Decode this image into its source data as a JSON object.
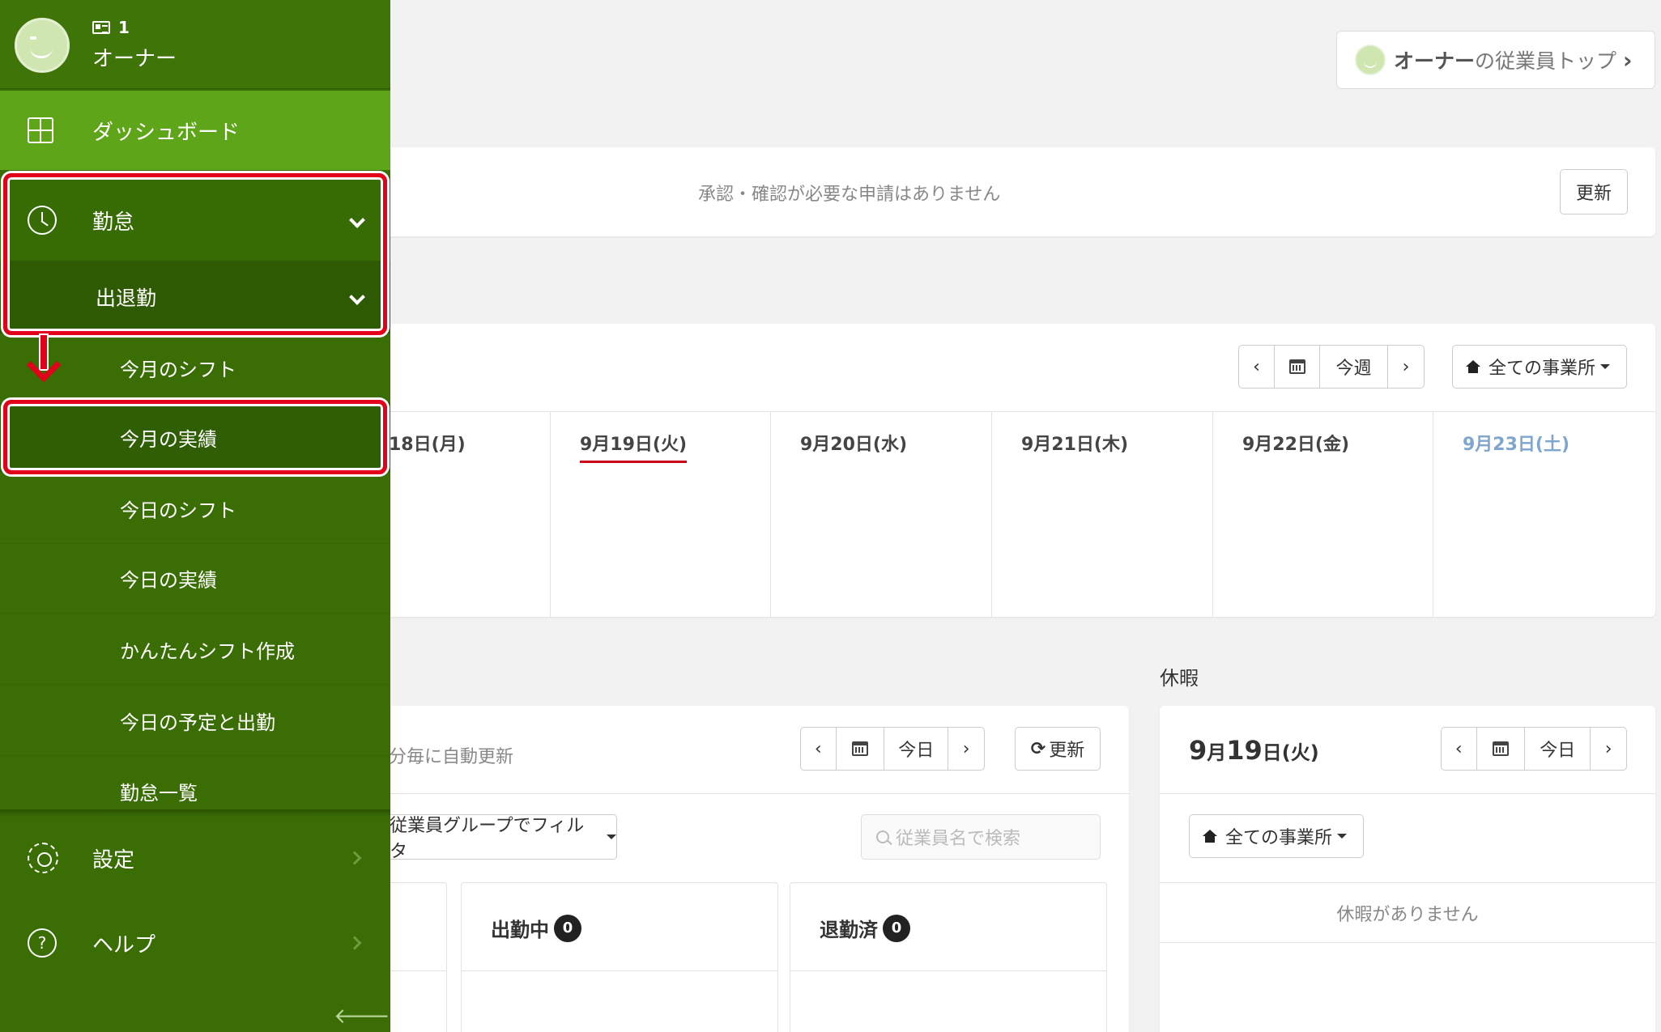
{
  "header": {
    "employee_top_owner": "オーナー",
    "employee_top_suffix": "の従業員トップ"
  },
  "approval": {
    "message": "承認・確認が必要な申請はありません",
    "refresh_label": "更新"
  },
  "week": {
    "today_label": "今週",
    "store_label": "全ての事業所",
    "days": [
      {
        "label": "18日(月)"
      },
      {
        "label": "9月19日(火)"
      },
      {
        "label": "9月20日(水)"
      },
      {
        "label": "9月21日(木)"
      },
      {
        "label": "9月22日(金)"
      },
      {
        "label": "9月23日(土)"
      }
    ]
  },
  "attendance": {
    "auto_refresh": "分毎に自動更新",
    "today_label": "今日",
    "refresh_label": "更新",
    "filter_label": "従業員グループでフィルタ",
    "search_placeholder": "従業員名で検索",
    "panels": [
      {
        "label": "出勤中",
        "count": "0"
      },
      {
        "label": "退勤済",
        "count": "0"
      }
    ]
  },
  "leave": {
    "section_title": "休暇",
    "date_month": "9",
    "date_month_suffix": "月",
    "date_day": "19",
    "date_day_suffix": "日(火)",
    "today_label": "今日",
    "store_label": "全ての事業所",
    "none_message": "休暇がありません"
  },
  "sidebar": {
    "user_id": "1",
    "user_role": "オーナー",
    "dashboard": "ダッシュボード",
    "kintai": "勤怠",
    "shukkin": "出退勤",
    "sub_items": [
      {
        "label": "今月のシフト"
      },
      {
        "label": "今月の実績"
      },
      {
        "label": "今日のシフト"
      },
      {
        "label": "今日の実績"
      },
      {
        "label": "かんたんシフト作成"
      },
      {
        "label": "今日の予定と出勤"
      },
      {
        "label": "勤怠一覧"
      }
    ],
    "settings": "設定",
    "help": "ヘルプ",
    "collapse_icon": "🡐"
  },
  "colors": {
    "sidebar_bg": "#3a6e05",
    "dashboard_bg": "#5fa51a",
    "highlight": "#e3001b",
    "today_underline": "#d0021b",
    "saturday": "#7ea6cf"
  }
}
